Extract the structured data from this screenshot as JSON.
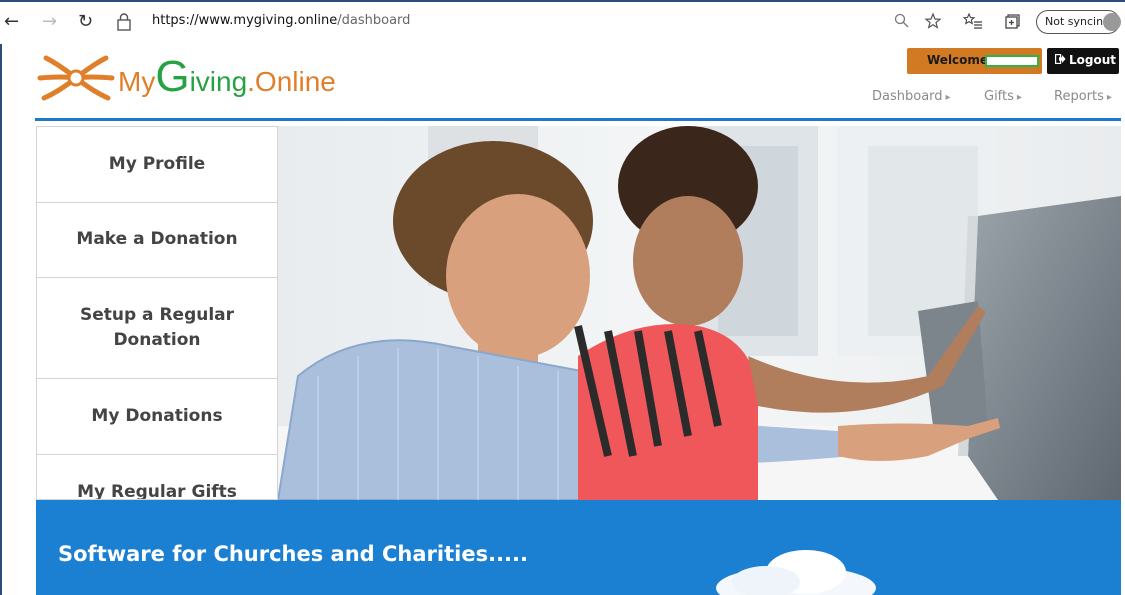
{
  "browser": {
    "url_host": "https://www.mygiving.online",
    "url_path": "/dashboard",
    "sync_label": "Not syncing",
    "icons": [
      "back-icon",
      "forward-icon",
      "reload-icon",
      "lock-icon",
      "zoom-icon",
      "favorite-star-icon",
      "favorites-list-icon",
      "collections-icon",
      "profile-avatar-icon"
    ]
  },
  "header": {
    "logo": {
      "my": "My",
      "g": "G",
      "iving": "iving",
      "online": ".Online"
    },
    "welcome_label": "Welcome:",
    "logout_label": "Logout",
    "nav": [
      {
        "label": "Dashboard"
      },
      {
        "label": "Gifts"
      },
      {
        "label": "Reports"
      }
    ]
  },
  "sidebar": {
    "items": [
      {
        "label": "My Profile"
      },
      {
        "label": "Make a Donation"
      },
      {
        "label": "Setup a Regular Donation"
      },
      {
        "label": "My Donations"
      },
      {
        "label": "My Regular Gifts"
      }
    ]
  },
  "banner": {
    "text": "Software for Churches and Charities....."
  },
  "colors": {
    "accent_blue": "#1b7fd2",
    "brand_orange": "#e07f2a",
    "brand_green": "#27a243",
    "welcome_bg": "#d27a23"
  }
}
